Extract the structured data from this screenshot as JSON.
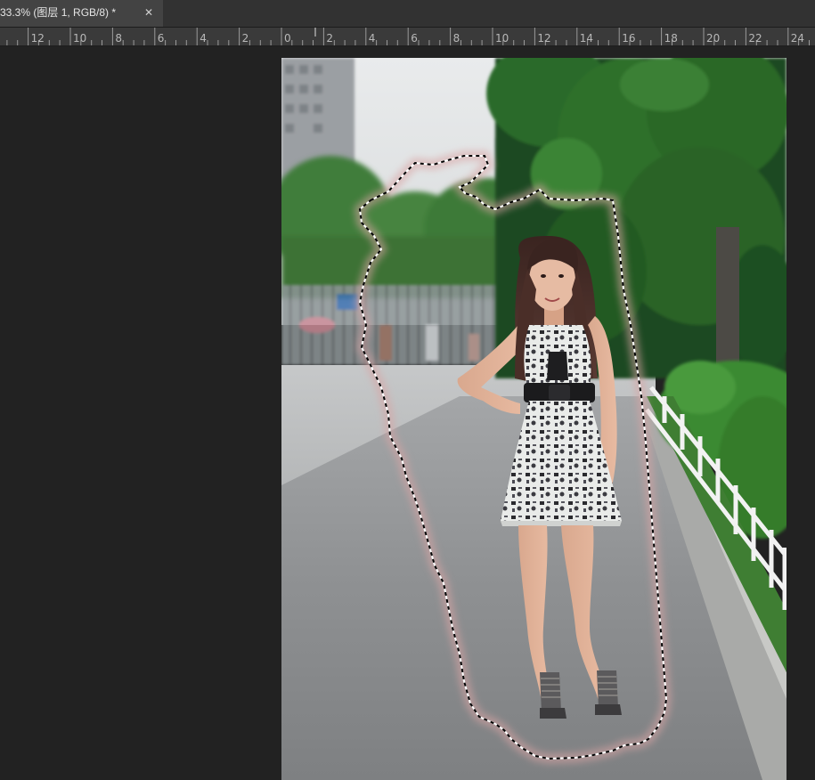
{
  "document_tab": {
    "title": "33.3% (图层 1, RGB/8) *",
    "close_icon": "close-icon"
  },
  "ruler": {
    "labels": [
      "12",
      "10",
      "8",
      "6",
      "4",
      "2",
      "0",
      "2",
      "4",
      "6",
      "8",
      "10",
      "12",
      "14",
      "16",
      "18",
      "20",
      "22",
      "24"
    ]
  },
  "canvas": {
    "background": "#222222",
    "image_subject": "photo",
    "selection": "marching-ants"
  },
  "colors": {
    "tab_active": "#434343",
    "tabbar": "#323232",
    "ruler_bg": "#3a3a3a",
    "workspace": "#222222"
  }
}
